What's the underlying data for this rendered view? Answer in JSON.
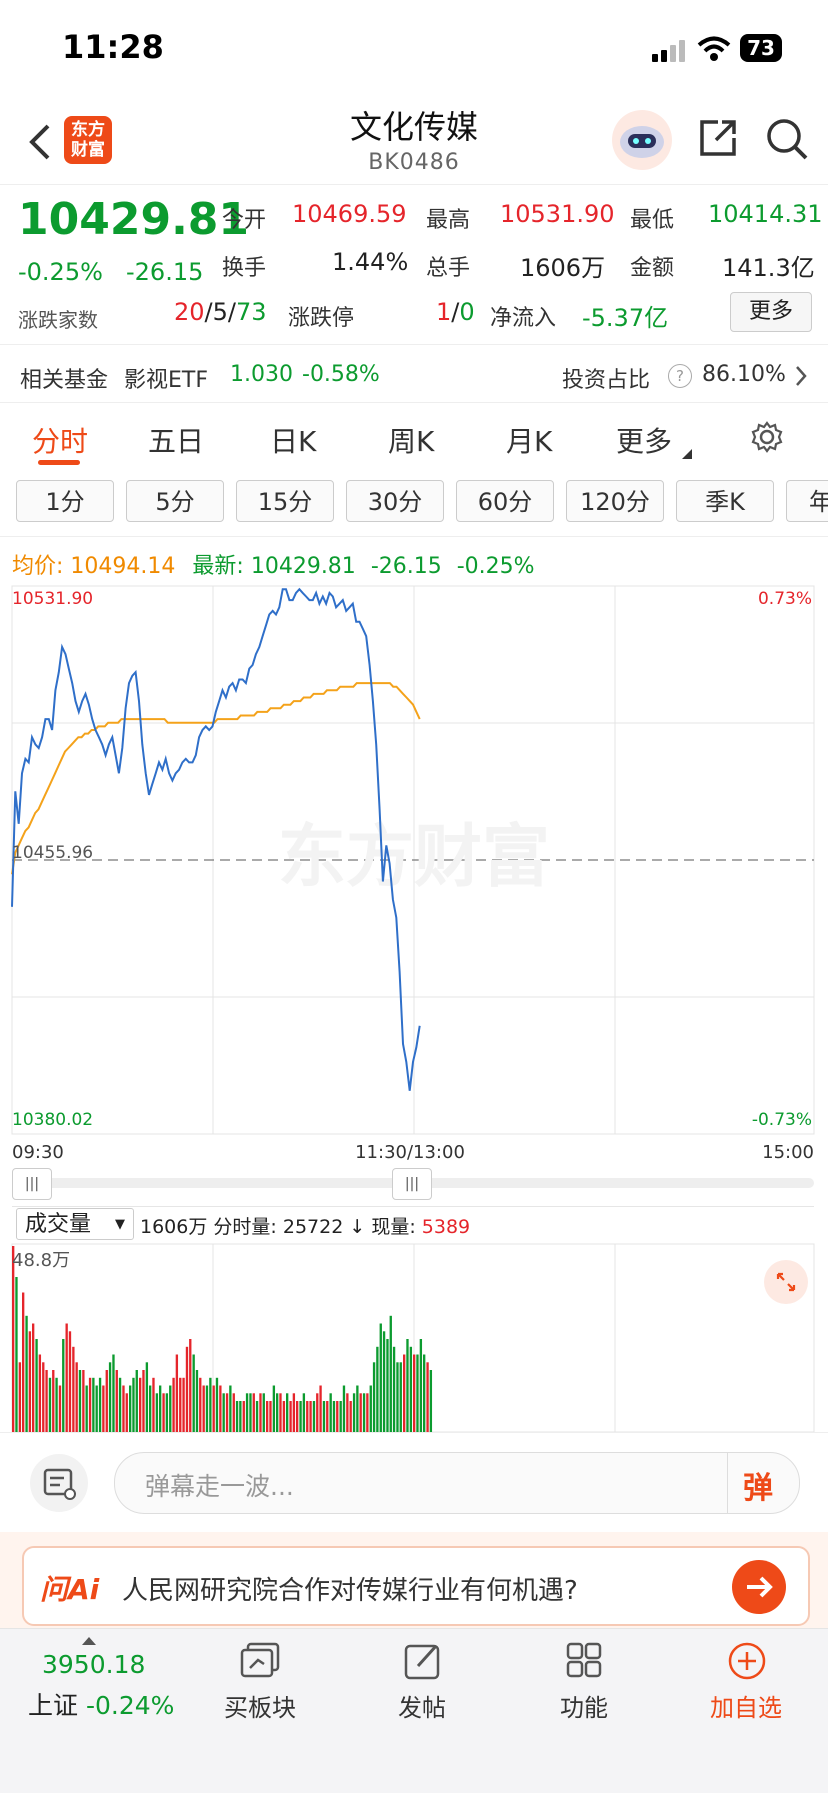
{
  "status": {
    "time": "11:28",
    "battery": "73"
  },
  "header": {
    "title": "文化传媒",
    "code": "BK0486",
    "logo_line1": "东方",
    "logo_line2": "财富"
  },
  "quote": {
    "price": "10429.81",
    "pct": "-0.25%",
    "chg": "-26.15",
    "open_label": "今开",
    "open": "10469.59",
    "high_label": "最高",
    "high": "10531.90",
    "low_label": "最低",
    "low": "10414.31",
    "turnover_label": "换手",
    "turnover": "1.44%",
    "volume_label": "总手",
    "volume": "1606万",
    "amount_label": "金额",
    "amount": "141.3亿",
    "breadth_label": "涨跌家数",
    "breadth_up": "20",
    "breadth_flat": "/5/",
    "breadth_down": "73",
    "limit_label": "涨跌停",
    "limit_up": "1",
    "limit_sep": "/",
    "limit_down": "0",
    "inflow_label": "净流入",
    "inflow": "-5.37亿",
    "more_button": "更多"
  },
  "fund": {
    "label": "相关基金",
    "name": "影视ETF",
    "price": "1.030",
    "pct": "-0.58%",
    "ratio_label": "投资占比",
    "ratio": "86.10%"
  },
  "tabs": [
    "分时",
    "五日",
    "日K",
    "周K",
    "月K",
    "更多"
  ],
  "periods": [
    "1分",
    "5分",
    "15分",
    "30分",
    "60分",
    "120分",
    "季K",
    "年"
  ],
  "legend": {
    "avg_label": "均价:",
    "avg": "10494.14",
    "latest_label": "最新:",
    "latest": "10429.81",
    "latest_chg": "-26.15",
    "latest_pct": "-0.25%"
  },
  "chart_data": {
    "type": "line",
    "ylim": [
      10380.02,
      10531.9
    ],
    "y_top_label": "10531.90",
    "y_mid_label": "10455.96",
    "y_bottom_label": "10380.02",
    "pct_top": "0.73%",
    "pct_bottom": "-0.73%",
    "x_labels": [
      "09:30",
      "11:30/13:00",
      "15:00"
    ],
    "watermark": "东方财富",
    "series": [
      {
        "color": "#2f6fc9",
        "values": [
          10443,
          10475,
          10466,
          10480,
          10484,
          10483,
          10490,
          10488,
          10487,
          10490,
          10495,
          10495,
          10492,
          10503,
          10508,
          10515,
          10513,
          10509,
          10505,
          10500,
          10497,
          10500,
          10502,
          10499,
          10495,
          10492,
          10490,
          10488,
          10485,
          10488,
          10490,
          10485,
          10480,
          10487,
          10498,
          10505,
          10507,
          10508,
          10500,
          10488,
          10480,
          10474,
          10477,
          10480,
          10483,
          10481,
          10484,
          10480,
          10478,
          10480,
          10481,
          10483,
          10484,
          10483,
          10483,
          10485,
          10490,
          10492,
          10493,
          10492,
          10493,
          10497,
          10500,
          10503,
          10501,
          10504,
          10505,
          10503,
          10506,
          10506,
          10505,
          10509,
          10510,
          10513,
          10515,
          10518,
          10521,
          10524,
          10525,
          10524,
          10526,
          10531,
          10531,
          10528,
          10528,
          10530,
          10531,
          10530,
          10529,
          10528,
          10528,
          10530,
          10527,
          10529,
          10527,
          10530,
          10529,
          10526,
          10527,
          10528,
          10525,
          10526,
          10527,
          10522,
          10522,
          10520,
          10518,
          10510,
          10500,
          10488,
          10470,
          10450,
          10460,
          10455,
          10445,
          10440,
          10425,
          10405,
          10400,
          10392,
          10400,
          10404,
          10410
        ]
      },
      {
        "color": "#f4a21a",
        "values": [
          10452,
          10458,
          10460,
          10462,
          10464,
          10465,
          10467,
          10469,
          10470,
          10472,
          10474,
          10476,
          10478,
          10480,
          10482,
          10484,
          10486,
          10487,
          10488,
          10489,
          10490,
          10490,
          10491,
          10491,
          10492,
          10492,
          10493,
          10493,
          10493,
          10494,
          10494,
          10494,
          10494,
          10495,
          10495,
          10495,
          10495,
          10495,
          10495,
          10495,
          10495,
          10495,
          10495,
          10495,
          10495,
          10495,
          10495,
          10494,
          10494,
          10494,
          10494,
          10494,
          10494,
          10494,
          10494,
          10494,
          10494,
          10494,
          10494,
          10494,
          10494,
          10494,
          10495,
          10495,
          10495,
          10495,
          10495,
          10495,
          10495,
          10496,
          10496,
          10496,
          10496,
          10496,
          10497,
          10497,
          10497,
          10497,
          10498,
          10498,
          10498,
          10498,
          10499,
          10499,
          10499,
          10500,
          10500,
          10500,
          10501,
          10501,
          10501,
          10502,
          10502,
          10502,
          10502,
          10503,
          10503,
          10503,
          10503,
          10504,
          10504,
          10504,
          10504,
          10504,
          10505,
          10505,
          10505,
          10505,
          10505,
          10505,
          10505,
          10505,
          10505,
          10505,
          10505,
          10504,
          10504,
          10503,
          10502,
          10501,
          10500,
          10499,
          10497,
          10495
        ]
      }
    ]
  },
  "volume": {
    "selector": "成交量",
    "total": "1606万",
    "tick_label": "分时量:",
    "tick": "25722",
    "tick_arrow": "↓",
    "current_label": "现量:",
    "current": "5389",
    "max_label": "48.8万",
    "bars": [
      48,
      40,
      18,
      36,
      30,
      26,
      28,
      24,
      20,
      18,
      16,
      14,
      16,
      14,
      12,
      24,
      28,
      26,
      22,
      18,
      16,
      16,
      12,
      14,
      14,
      12,
      14,
      12,
      16,
      18,
      20,
      16,
      14,
      12,
      10,
      12,
      14,
      16,
      14,
      16,
      18,
      12,
      14,
      10,
      12,
      10,
      10,
      12,
      14,
      20,
      14,
      14,
      22,
      24,
      20,
      16,
      14,
      12,
      12,
      14,
      12,
      14,
      12,
      10,
      10,
      12,
      10,
      8,
      8,
      8,
      10,
      10,
      10,
      8,
      10,
      10,
      8,
      8,
      12,
      10,
      10,
      8,
      10,
      8,
      10,
      8,
      8,
      10,
      8,
      8,
      8,
      10,
      12,
      8,
      8,
      10,
      8,
      8,
      8,
      12,
      10,
      8,
      10,
      12,
      10,
      10,
      10,
      12,
      18,
      22,
      28,
      26,
      24,
      30,
      22,
      18,
      18,
      20,
      24,
      22,
      20,
      20,
      24,
      20,
      18,
      16
    ],
    "colors": [
      "r",
      "g",
      "r",
      "r",
      "g",
      "r",
      "r",
      "g",
      "r",
      "r",
      "r",
      "g",
      "r",
      "g",
      "r",
      "g",
      "r",
      "r",
      "r",
      "r",
      "g",
      "r",
      "g",
      "r",
      "g",
      "g",
      "g",
      "r",
      "r",
      "g",
      "g",
      "r",
      "g",
      "r",
      "r",
      "g",
      "g",
      "g",
      "r",
      "r",
      "g",
      "g",
      "r",
      "g",
      "g",
      "r",
      "g",
      "g",
      "r",
      "r",
      "r",
      "r",
      "r",
      "r",
      "g",
      "g",
      "r",
      "r",
      "g",
      "g",
      "r",
      "g",
      "r",
      "g",
      "r",
      "g",
      "r",
      "g",
      "g",
      "r",
      "g",
      "g",
      "r",
      "g",
      "r",
      "g",
      "r",
      "r",
      "g",
      "g",
      "r",
      "r",
      "g",
      "r",
      "r",
      "r",
      "g",
      "g",
      "r",
      "r",
      "g",
      "r",
      "r",
      "g",
      "r",
      "g",
      "g",
      "r",
      "g",
      "g",
      "r",
      "r",
      "g",
      "g",
      "r",
      "g",
      "r",
      "g",
      "g",
      "g",
      "g",
      "g",
      "g",
      "g",
      "g",
      "g",
      "g",
      "r",
      "g",
      "g",
      "r",
      "g",
      "g",
      "g",
      "r",
      "g"
    ]
  },
  "comment": {
    "placeholder": "弹幕走一波...",
    "danmu": "弹"
  },
  "ai": {
    "logo": "问Ai",
    "text": "人民网研究院合作对传媒行业有何机遇?"
  },
  "bottom": {
    "index_value": "3950.18",
    "index_name": "上证",
    "index_pct": "-0.24%",
    "items": [
      "买板块",
      "发帖",
      "功能",
      "加自选"
    ]
  }
}
